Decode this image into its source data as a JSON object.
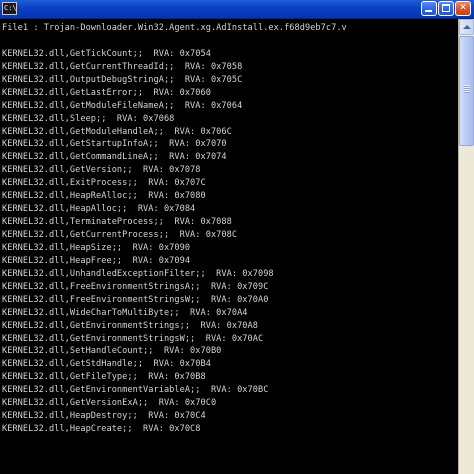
{
  "window": {
    "title": "",
    "app_icon_label": "C:\\",
    "buttons": {
      "minimize": "minimize",
      "maximize": "maximize",
      "close": "✕"
    }
  },
  "console": {
    "lines": [
      "File1 : Trojan-Downloader.Win32.Agent.xg.AdInstall.ex.f68d9eb7c7.v",
      "",
      "KERNEL32.dll,GetTickCount;;  RVA: 0x7054",
      "KERNEL32.dll,GetCurrentThreadId;;  RVA: 0x7058",
      "KERNEL32.dll,OutputDebugStringA;;  RVA: 0x705C",
      "KERNEL32.dll,GetLastError;;  RVA: 0x7060",
      "KERNEL32.dll,GetModuleFileNameA;;  RVA: 0x7064",
      "KERNEL32.dll,Sleep;;  RVA: 0x7068",
      "KERNEL32.dll,GetModuleHandleA;;  RVA: 0x706C",
      "KERNEL32.dll,GetStartupInfoA;;  RVA: 0x7070",
      "KERNEL32.dll,GetCommandLineA;;  RVA: 0x7074",
      "KERNEL32.dll,GetVersion;;  RVA: 0x7078",
      "KERNEL32.dll,ExitProcess;;  RVA: 0x707C",
      "KERNEL32.dll,HeapReAlloc;;  RVA: 0x7080",
      "KERNEL32.dll,HeapAlloc;;  RVA: 0x7084",
      "KERNEL32.dll,TerminateProcess;;  RVA: 0x7088",
      "KERNEL32.dll,GetCurrentProcess;;  RVA: 0x708C",
      "KERNEL32.dll,HeapSize;;  RVA: 0x7090",
      "KERNEL32.dll,HeapFree;;  RVA: 0x7094",
      "KERNEL32.dll,UnhandledExceptionFilter;;  RVA: 0x7098",
      "KERNEL32.dll,FreeEnvironmentStringsA;;  RVA: 0x709C",
      "KERNEL32.dll,FreeEnvironmentStringsW;;  RVA: 0x70A0",
      "KERNEL32.dll,WideCharToMultiByte;;  RVA: 0x70A4",
      "KERNEL32.dll,GetEnvironmentStrings;;  RVA: 0x70A8",
      "KERNEL32.dll,GetEnvironmentStringsW;;  RVA: 0x70AC",
      "KERNEL32.dll,SetHandleCount;;  RVA: 0x70B0",
      "KERNEL32.dll,GetStdHandle;;  RVA: 0x70B4",
      "KERNEL32.dll,GetFileType;;  RVA: 0x70B8",
      "KERNEL32.dll,GetEnvironmentVariableA;;  RVA: 0x70BC",
      "KERNEL32.dll,GetVersionExA;;  RVA: 0x70C0",
      "KERNEL32.dll,HeapDestroy;;  RVA: 0x70C4",
      "KERNEL32.dll,HeapCreate;;  RVA: 0x70C8"
    ]
  },
  "colors": {
    "console_background": "#000000",
    "console_text": "#d4d4d4",
    "titlebar": "#0a3fc4",
    "close_button": "#d9542c"
  }
}
